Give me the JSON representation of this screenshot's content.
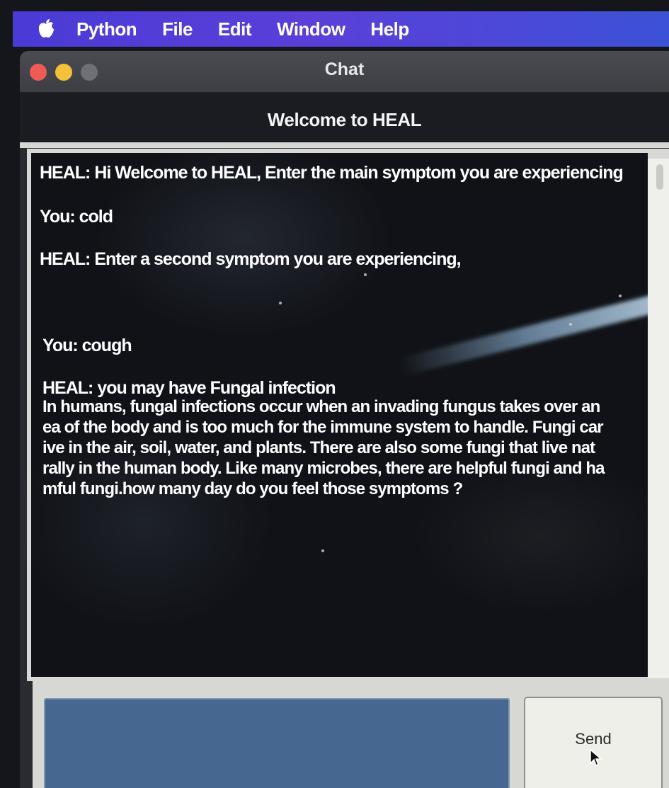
{
  "menubar": {
    "apple_icon": "apple-logo-icon",
    "items": [
      "Python",
      "File",
      "Edit",
      "Window",
      "Help"
    ]
  },
  "window": {
    "title": "Chat",
    "header": "Welcome to HEAL"
  },
  "chat": {
    "messages": [
      "HEAL: Hi Welcome to HEAL, Enter the main symptom you are experiencing",
      "You: cold",
      "HEAL: Enter a second symptom you are experiencing,",
      "You: cough",
      "HEAL: you may have Fungal infection"
    ],
    "diagnosis_lines": [
      "In humans, fungal infections occur when an invading fungus takes over an",
      "ea of the body and is too much for the immune system to handle. Fungi car",
      "ive in the air, soil, water, and plants. There are also some fungi that live nat",
      "rally in the human body. Like many microbes, there are helpful fungi and ha",
      "mful fungi.how many day do you feel those symptoms ?"
    ]
  },
  "input": {
    "value": "",
    "send_label": "Send"
  },
  "colors": {
    "menubar": "#4a3bd6",
    "input_bg": "#46678f",
    "chat_bg": "#101217"
  }
}
